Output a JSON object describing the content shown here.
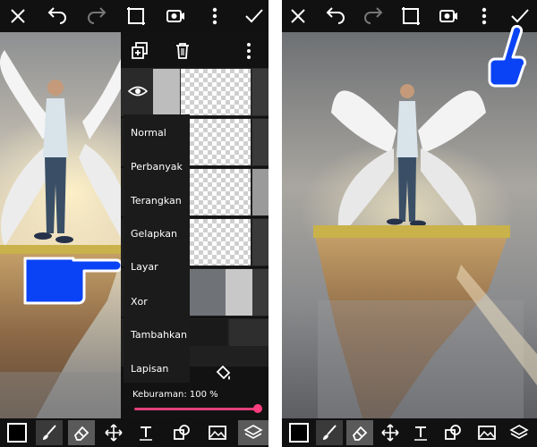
{
  "left_panel": {
    "layers_panel": {
      "opacity_label": "Keburaman: 100 %",
      "opacity_value": 100
    },
    "blend_menu": {
      "items": [
        "Normal",
        "Perbanyak",
        "Terangkan",
        "Gelapkan",
        "Layar",
        "Xor",
        "Tambahkan",
        "Lapisan"
      ]
    },
    "pointer_hand_color": "#0a43f5"
  },
  "right_panel": {
    "pointer_hand_color": "#0a43f5"
  },
  "colors": {
    "accent": "#ff3d7f",
    "toolbar_bg": "#111111",
    "icon": "#ffffff",
    "hand": "#0a43f5"
  },
  "icons": {
    "top_toolbar": [
      "close-icon",
      "undo-icon",
      "redo-icon",
      "crop-icon",
      "record-icon",
      "more-vert-icon",
      "checkmark-icon"
    ],
    "bottom_toolbar": [
      "color-swatch-icon",
      "brush-icon",
      "eraser-icon",
      "move-icon",
      "text-icon",
      "shapes-icon",
      "image-icon",
      "layers-icon"
    ]
  }
}
